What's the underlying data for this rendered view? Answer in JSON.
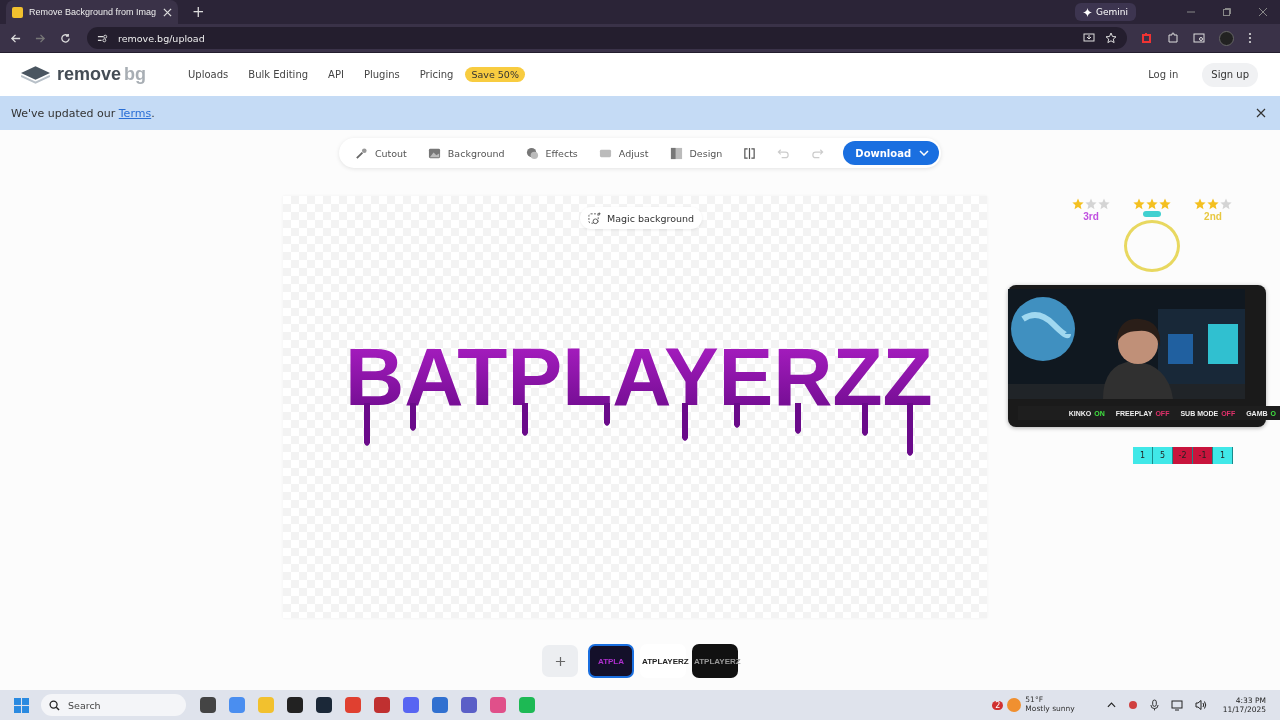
{
  "browser": {
    "tab_title": "Remove Background from Imag",
    "new_tab": "+",
    "gemini": "Gemini",
    "url": "remove.bg/upload"
  },
  "site": {
    "logo_main": "remove",
    "logo_accent": "bg",
    "nav": [
      {
        "label": "Uploads"
      },
      {
        "label": "Bulk Editing"
      },
      {
        "label": "API"
      },
      {
        "label": "Plugins"
      },
      {
        "label": "Pricing"
      }
    ],
    "badge": "Save 50%",
    "login": "Log in",
    "signup": "Sign up"
  },
  "banner": {
    "before": "We've updated our ",
    "link": "Terms",
    "after": "."
  },
  "toolbar": {
    "tools": [
      {
        "kind": "cutout",
        "label": "Cutout"
      },
      {
        "kind": "background",
        "label": "Background"
      },
      {
        "kind": "effects",
        "label": "Effects"
      },
      {
        "kind": "adjust",
        "label": "Adjust"
      },
      {
        "kind": "design",
        "label": "Design"
      }
    ],
    "actions": [
      {
        "kind": "compare",
        "disabled": false
      },
      {
        "kind": "undo",
        "disabled": true
      },
      {
        "kind": "redo",
        "disabled": true
      }
    ],
    "download": "Download"
  },
  "canvas": {
    "magic": "Magic background",
    "image_text": "BATPLAYERZZ"
  },
  "thumbnails": [
    {
      "kind": "dark",
      "text": "ATPLA",
      "selected": true
    },
    {
      "kind": "light",
      "text": "ATPLAYERZ",
      "selected": false
    },
    {
      "kind": "black",
      "text": "ATPLAYERZ",
      "selected": false
    }
  ],
  "overlay": {
    "ranks": [
      {
        "label": "3rd",
        "stars": 1,
        "color": "#c050e0"
      },
      {
        "stars": 3,
        "color": "#40d0d0"
      },
      {
        "label": "2nd",
        "stars": 2,
        "color": "#e8c840"
      }
    ],
    "modes": [
      {
        "label": "KINKO",
        "value": "ON",
        "on": true
      },
      {
        "label": "FREEPLAY",
        "value": "OFF",
        "on": false
      },
      {
        "label": "SUB MODE",
        "value": "OFF",
        "on": false
      },
      {
        "label": "GAMB",
        "value": "O",
        "on": true
      }
    ],
    "counter": [
      {
        "text": "1",
        "color": "#40e8e8"
      },
      {
        "text": "5",
        "color": "#40e8e8"
      },
      {
        "text": "-2",
        "color": "#c8143c"
      },
      {
        "text": "-1",
        "color": "#c8143c"
      },
      {
        "text": "1",
        "color": "#40e8e8"
      }
    ]
  },
  "taskbar": {
    "search": "Search",
    "weather_badge": "2",
    "temperature": "51°F",
    "condition": "Mostly sunny",
    "time": "4:33 PM",
    "date": "11/17/2025"
  }
}
